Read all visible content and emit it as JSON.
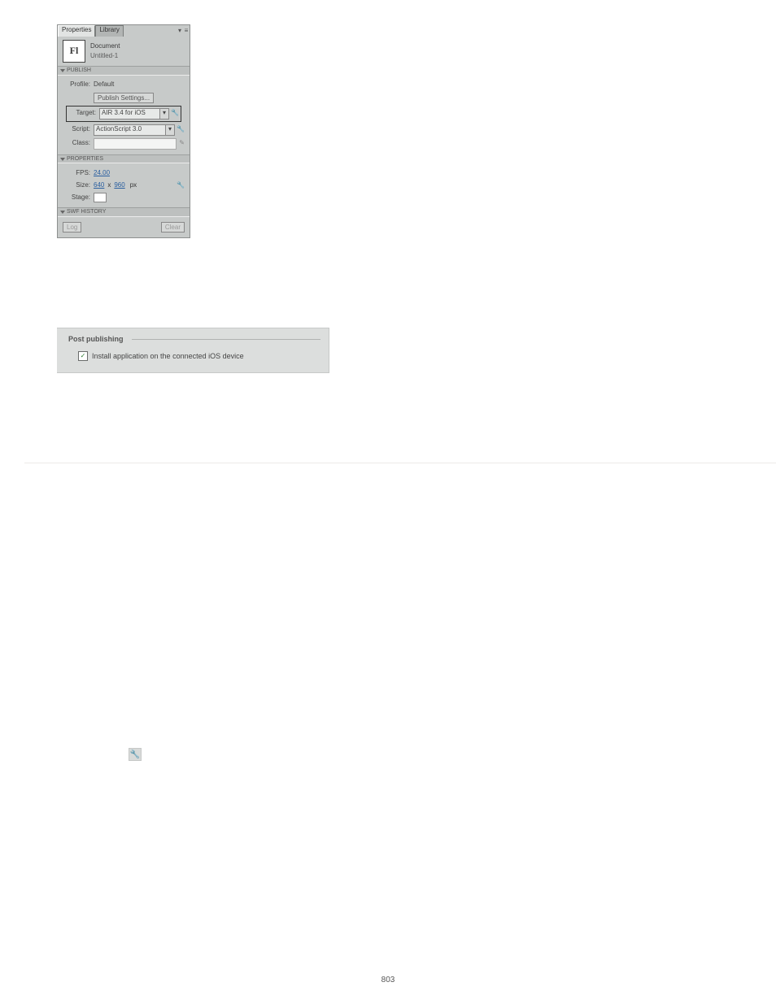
{
  "panel": {
    "tabs": {
      "properties": "Properties",
      "library": "Library"
    },
    "document_label": "Document",
    "document_name": "Untitled-1",
    "fl_mark": "Fl"
  },
  "sections": {
    "publish": {
      "title": "PUBLISH",
      "profile_label": "Profile:",
      "profile_value": "Default",
      "publish_settings_btn": "Publish Settings...",
      "target_label": "Target:",
      "target_value": "AIR 3.4 for iOS",
      "script_label": "Script:",
      "script_value": "ActionScript 3.0",
      "class_label": "Class:"
    },
    "properties": {
      "title": "PROPERTIES",
      "fps_label": "FPS:",
      "fps_value": "24.00",
      "size_label": "Size:",
      "size_w": "640",
      "size_x": "x",
      "size_h": "960",
      "size_px": "px",
      "stage_label": "Stage:"
    },
    "swf_history": {
      "title": "SWF HISTORY",
      "log_btn": "Log",
      "clear_btn": "Clear"
    }
  },
  "post_publishing": {
    "title": "Post publishing",
    "checkbox_label": "Install application on the connected iOS device",
    "checked": true
  },
  "page_number": "803"
}
